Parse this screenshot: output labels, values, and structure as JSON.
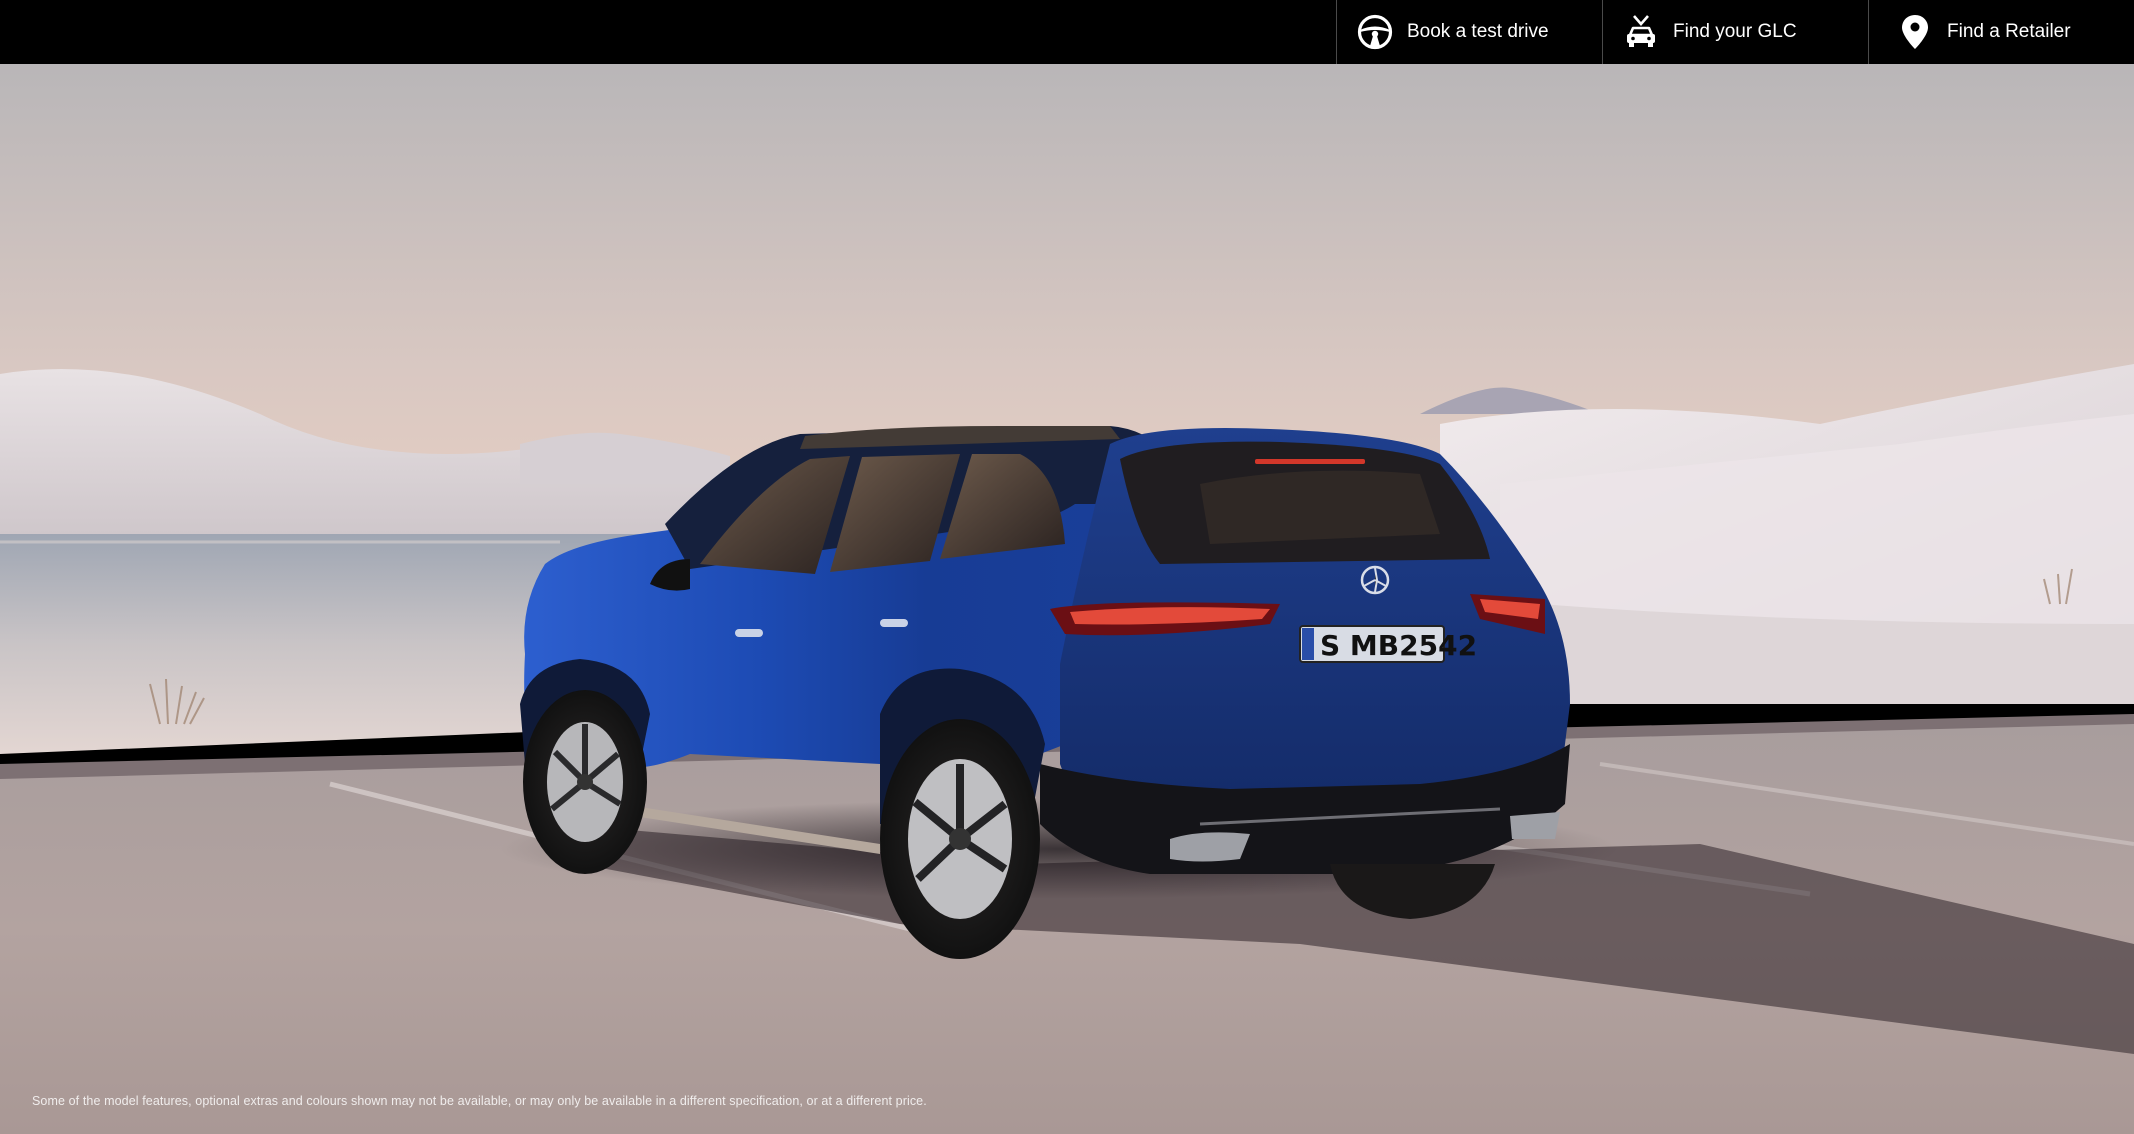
{
  "nav": {
    "items": [
      {
        "label": "Book a test drive",
        "icon": "steering-wheel-icon"
      },
      {
        "label": "Find your GLC",
        "icon": "car-search-icon"
      },
      {
        "label": "Find a Retailer",
        "icon": "location-pin-icon"
      }
    ]
  },
  "hero": {
    "license_plate": "S MB2542",
    "disclaimer": "Some of the model features, optional extras and colours shown may not be available, or may only be available in a different specification, or at a different price."
  },
  "colors": {
    "topbar": "#000000",
    "car_body": "#1f47a8",
    "sky_top": "#b9b6b7",
    "sky_bottom": "#e7cdbd"
  }
}
